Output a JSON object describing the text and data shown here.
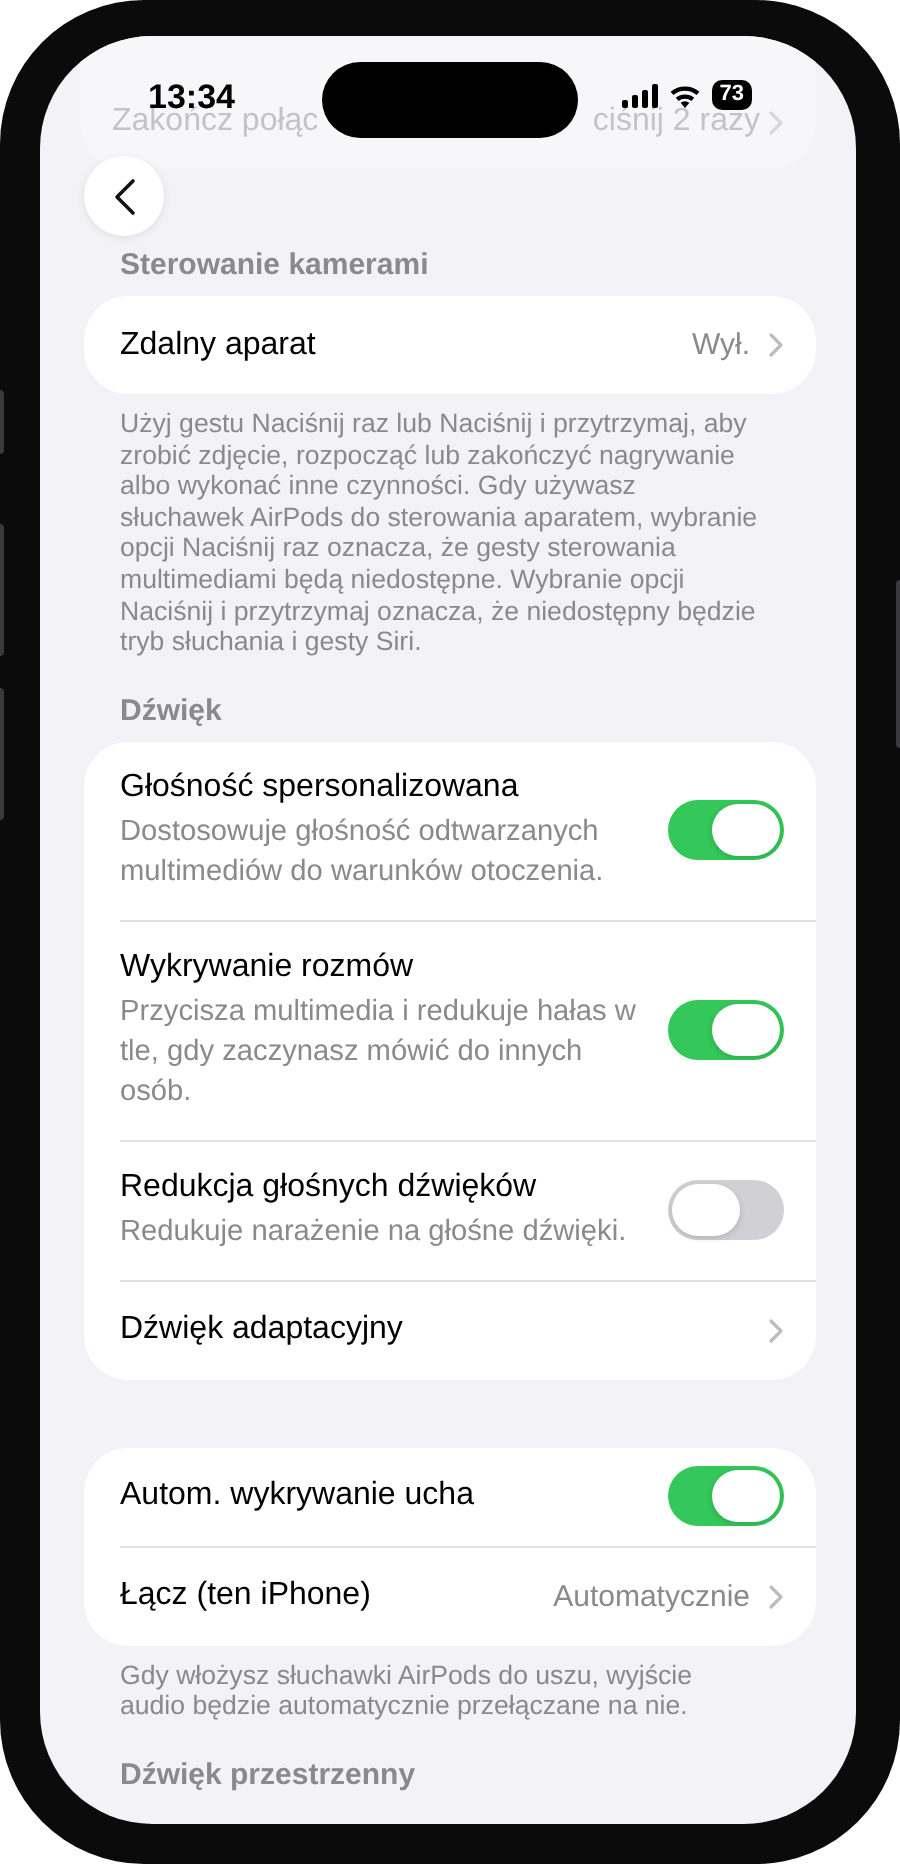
{
  "status_bar": {
    "time": "13:34",
    "battery": "73"
  },
  "hidden_row": {
    "label": "Zakończ połąc",
    "value": "ciśnij 2 razy"
  },
  "sections": [
    {
      "header": "Sterowanie kamerami",
      "rows": [
        {
          "kind": "value",
          "label": "Zdalny aparat",
          "value": "Wył."
        }
      ],
      "footer": "Użyj gestu Naciśnij raz lub Naciśnij i przytrzymaj, aby zrobić zdjęcie, rozpocząć lub zakończyć nagrywanie albo wykonać inne czynności. Gdy używasz słuchawek AirPods do sterowania aparatem, wybranie opcji Naciśnij raz oznacza, że gesty sterowania multimediami będą niedostępne. Wybranie opcji Naciśnij i przytrzymaj oznacza, że niedostępny będzie tryb słuchania i gesty Siri."
    },
    {
      "header": "Dźwięk",
      "rows": [
        {
          "kind": "toggle",
          "label": "Głośność spersonalizowana",
          "subtitle": "Dostosowuje głośność odtwarzanych multimediów do warunków otoczenia.",
          "on": true
        },
        {
          "kind": "toggle",
          "label": "Wykrywanie rozmów",
          "subtitle": "Przycisza multimedia i redukuje hałas w tle, gdy zaczynasz mówić do innych osób.",
          "on": true
        },
        {
          "kind": "toggle",
          "label": "Redukcja głośnych dźwięków",
          "subtitle": "Redukuje narażenie na głośne dźwięki.",
          "on": false
        },
        {
          "kind": "link",
          "label": "Dźwięk adaptacyjny"
        }
      ]
    },
    {
      "rows": [
        {
          "kind": "toggle",
          "label": "Autom. wykrywanie ucha",
          "on": true
        },
        {
          "kind": "value",
          "label": "Łącz (ten iPhone)",
          "value": "Automatycznie"
        }
      ],
      "footer": "Gdy włożysz słuchawki AirPods do uszu, wyjście audio będzie automatycznie przełączane na nie."
    },
    {
      "header": "Dźwięk przestrzenny"
    }
  ]
}
